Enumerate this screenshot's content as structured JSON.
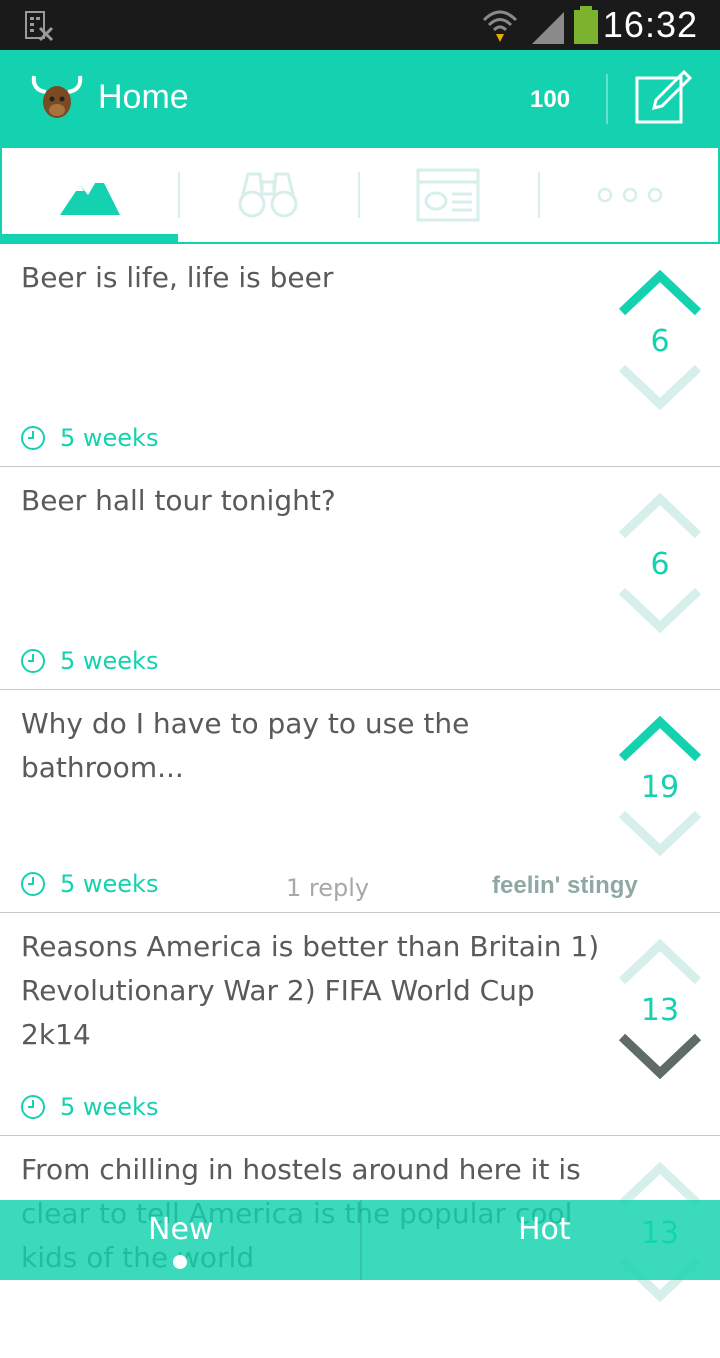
{
  "status_bar": {
    "time": "16:32"
  },
  "header": {
    "title": "Home",
    "karma": "100"
  },
  "tabs": [
    {
      "icon": "mountains-icon",
      "active": true
    },
    {
      "icon": "binoculars-icon",
      "active": false
    },
    {
      "icon": "id-card-icon",
      "active": false
    },
    {
      "icon": "more-dots-icon",
      "active": false
    }
  ],
  "posts": [
    {
      "text": "Beer is life, life is beer",
      "votes": "6",
      "time": "5 weeks",
      "replies": "",
      "handle": "",
      "vote_state": "up"
    },
    {
      "text": "Beer hall tour tonight?",
      "votes": "6",
      "time": "5 weeks",
      "replies": "",
      "handle": "",
      "vote_state": "none"
    },
    {
      "text": "Why do I have to pay to use the bathroom...",
      "votes": "19",
      "time": "5 weeks",
      "replies": "1 reply",
      "handle": "feelin' stingy",
      "vote_state": "up"
    },
    {
      "text": "Reasons America is better than Britain 1) Revolutionary War 2) FIFA World Cup 2k14",
      "votes": "13",
      "time": "5 weeks",
      "replies": "",
      "handle": "",
      "vote_state": "down"
    },
    {
      "text": "From chilling in hostels around here it is clear to tell America is the popular cool kids of the world",
      "votes": "13",
      "time": "",
      "replies": "",
      "handle": "",
      "vote_state": "none"
    }
  ],
  "bottom_tabs": {
    "new_label": "New",
    "hot_label": "Hot"
  },
  "colors": {
    "accent": "#14d2b0",
    "accent_light": "#d6efea",
    "down_active": "#5f6b69"
  }
}
